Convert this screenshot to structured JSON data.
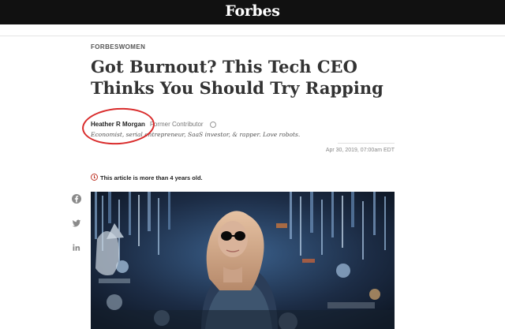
{
  "header": {
    "logo": "Forbes"
  },
  "article": {
    "section": "FORBESWOMEN",
    "headline": "Got Burnout? This Tech CEO Thinks You Should Try Rapping",
    "author": {
      "name": "Heather R Morgan",
      "role": "Former Contributor",
      "bio": "Economist, serial entrepreneur, SaaS investor, & rapper. Love robots."
    },
    "date": "Apr 30, 2019, 07:00am EDT",
    "age_note": "This article is more than 4 years old."
  },
  "social": {
    "icons": [
      "facebook-icon",
      "twitter-icon",
      "linkedin-icon"
    ]
  },
  "colors": {
    "topbar": "#111111",
    "annotation_circle": "#d92b2b",
    "age_icon": "#c0392b"
  }
}
